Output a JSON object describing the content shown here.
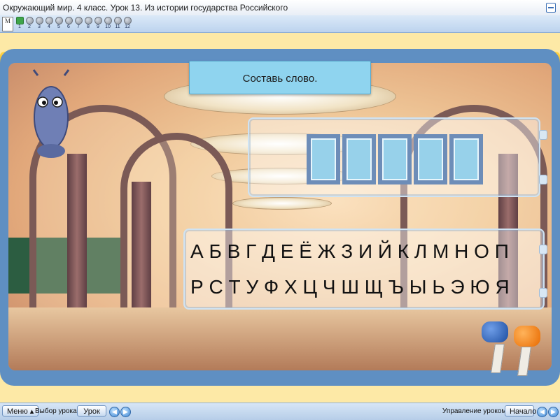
{
  "window": {
    "title": "Окружающий мир. 4 класс. Урок 13. Из истории государства Российского",
    "logo_text": "M"
  },
  "lesson_pages": [
    "1",
    "2",
    "3",
    "4",
    "5",
    "6",
    "7",
    "8",
    "9",
    "10",
    "11",
    "12"
  ],
  "task": {
    "instruction": "Составь слово."
  },
  "alphabet": {
    "row1": "А Б В Г Д Е Ё Ж З  И Й К Л М Н О П",
    "row2": "Р С Т У Ф Х Ц Ч  Ш Щ Ъ Ы Ь  Э Ю Я"
  },
  "answer_slots": 5,
  "footer": {
    "menu_label": "Меню",
    "lesson_select_label": "Выбор урока:",
    "lesson_button": "Урок",
    "lesson_control_label": "Управление уроком:",
    "start_button": "Начало"
  },
  "colors": {
    "accent_blue": "#3e86d2",
    "task_box": "#8fd4ef",
    "frame_blue": "#5f8fc2",
    "beam_yellow": "#f2b300"
  },
  "icons": {
    "minimize": "minimize-icon",
    "prev": "arrow-left-icon",
    "next": "arrow-right-icon"
  }
}
